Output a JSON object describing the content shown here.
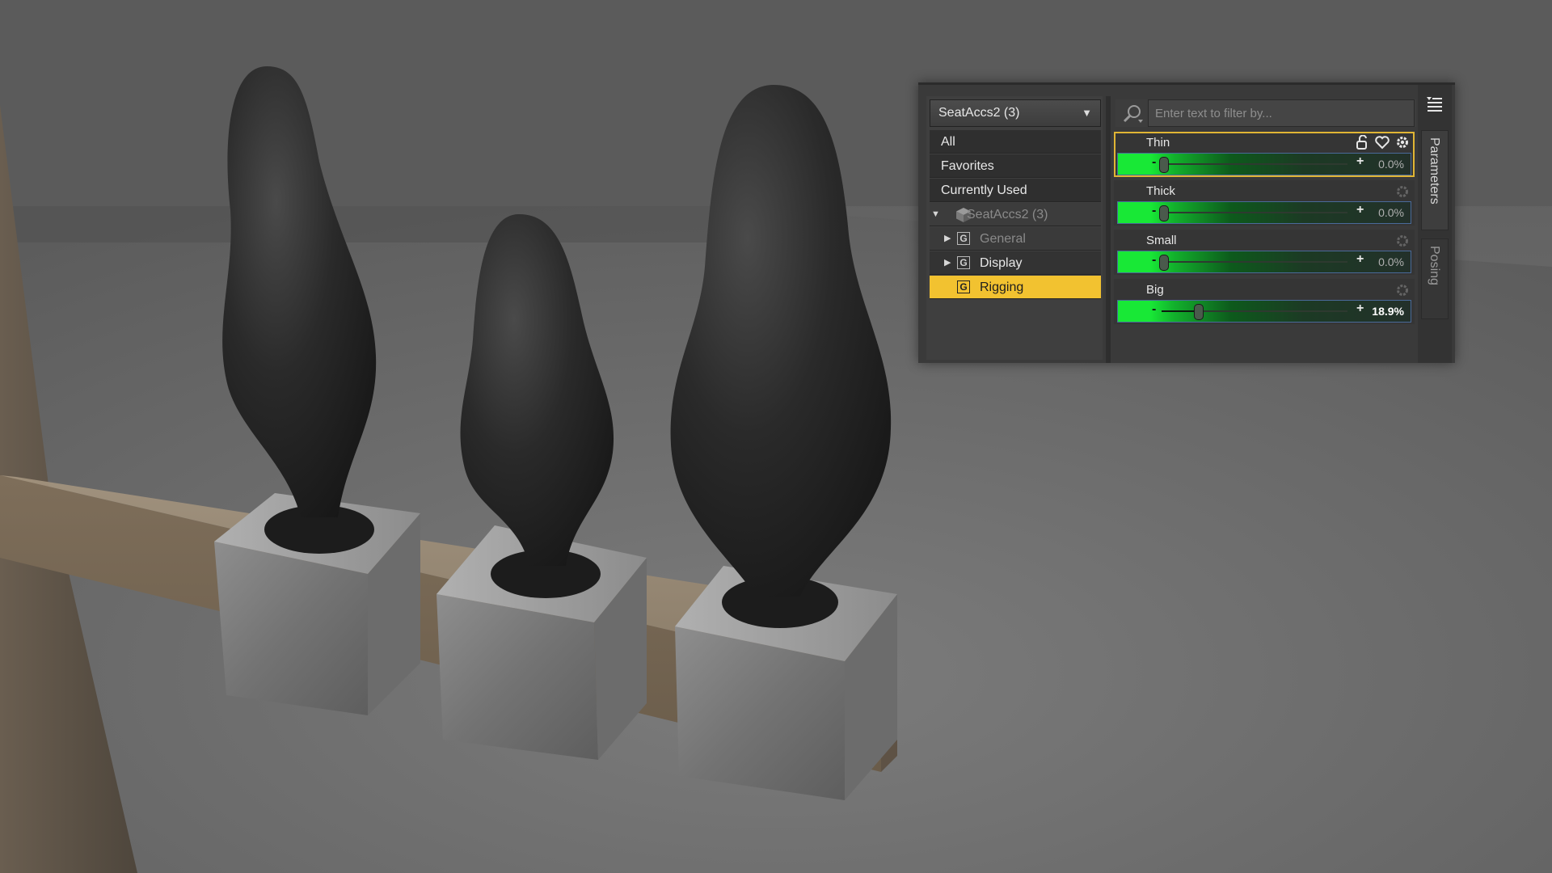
{
  "node_selector": {
    "label": "SeatAccs2 (3)"
  },
  "filter": {
    "placeholder": "Enter text to filter by..."
  },
  "tree": {
    "all": "All",
    "favorites": "Favorites",
    "currently_used": "Currently Used",
    "node": "SeatAccs2 (3)",
    "groups": [
      {
        "label": "General",
        "expanded": false
      },
      {
        "label": "Display",
        "expanded": false
      },
      {
        "label": "Rigging",
        "selected": true
      }
    ]
  },
  "parameters": [
    {
      "name": "Thin",
      "value_text": "0.0%",
      "value": 0.0
    },
    {
      "name": "Thick",
      "value_text": "0.0%",
      "value": 0.0
    },
    {
      "name": "Small",
      "value_text": "0.0%",
      "value": 0.0
    },
    {
      "name": "Big",
      "value_text": "18.9%",
      "value": 18.9
    }
  ],
  "slider_symbols": {
    "minus": "-",
    "plus": "+"
  },
  "side_tabs": [
    "Parameters",
    "Posing"
  ],
  "colors": {
    "selection": "#f2c230",
    "slider_green": "#18e836",
    "active_outline": "#e0b534"
  }
}
